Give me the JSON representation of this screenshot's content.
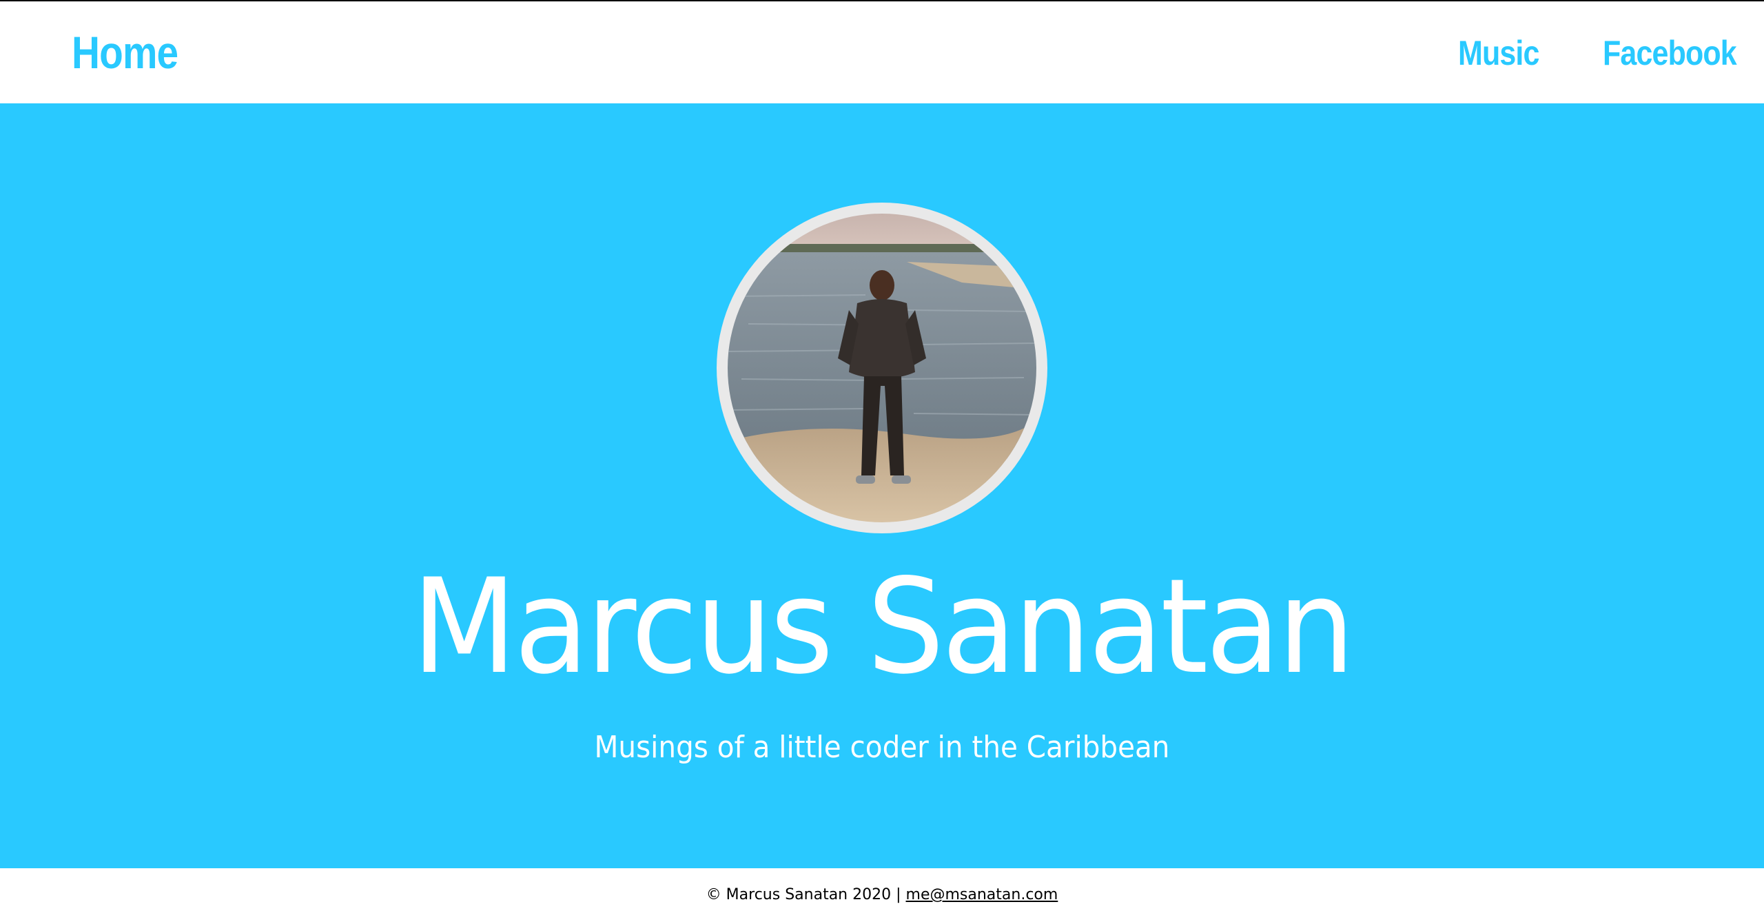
{
  "colors": {
    "accent": "#29c9ff",
    "hero_background": "#29c9ff",
    "avatar_ring": "#e9e9e9",
    "hero_text": "#ffffff",
    "footer_text": "#000000"
  },
  "nav": {
    "home_label": "Home",
    "links": [
      {
        "label": "Music"
      },
      {
        "label": "Facebook"
      }
    ]
  },
  "hero": {
    "avatar_alt": "photo",
    "title": "Marcus Sanatan",
    "subtitle": "Musings of a little coder in the Caribbean"
  },
  "footer": {
    "copyright": "© Marcus Sanatan 2020 | ",
    "email": "me@msanatan.com"
  }
}
